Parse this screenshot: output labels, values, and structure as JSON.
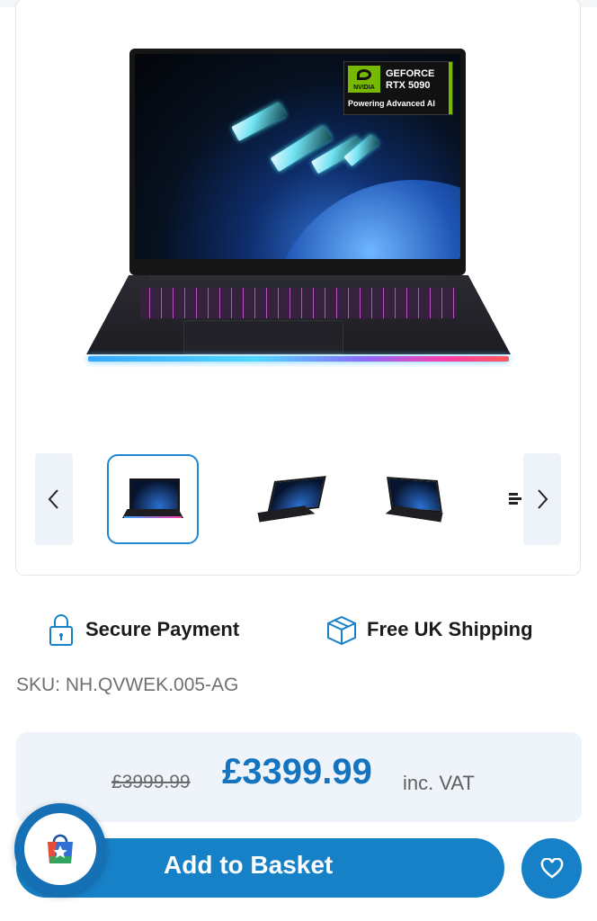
{
  "product": {
    "badge": {
      "brand": "NVIDIA",
      "line1": "GEFORCE",
      "line2": "RTX 5090",
      "tagline": "Powering Advanced AI"
    },
    "gallery": {
      "prev_icon": "chevron-left-icon",
      "next_icon": "chevron-right-icon"
    }
  },
  "features": [
    {
      "icon": "padlock-icon",
      "label": "Secure Payment"
    },
    {
      "icon": "box-icon",
      "label": "Free UK Shipping"
    }
  ],
  "sku": "SKU: NH.QVWEK.005-AG",
  "pricing": {
    "old_price": "£3999.99",
    "new_price": "£3399.99",
    "vat_label": "inc. VAT"
  },
  "actions": {
    "add_to_basket": "Add to Basket",
    "wishlist_icon": "heart-icon"
  },
  "colors": {
    "accent": "#1781c8",
    "price": "#1574c0"
  }
}
